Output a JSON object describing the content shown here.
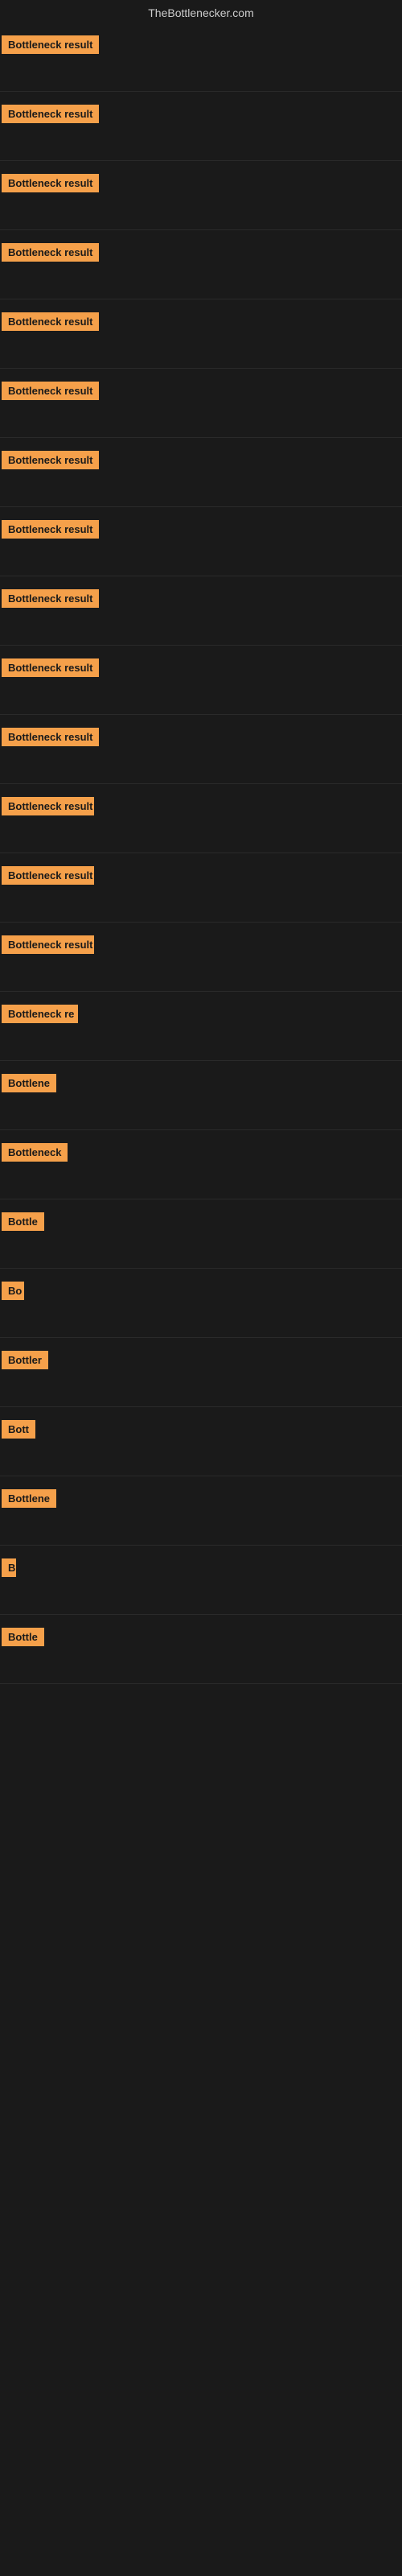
{
  "site": {
    "title": "TheBottlenecker.com"
  },
  "rows": [
    {
      "id": 1,
      "label": "Bottleneck result",
      "width": 130
    },
    {
      "id": 2,
      "label": "Bottleneck result",
      "width": 130
    },
    {
      "id": 3,
      "label": "Bottleneck result",
      "width": 130
    },
    {
      "id": 4,
      "label": "Bottleneck result",
      "width": 130
    },
    {
      "id": 5,
      "label": "Bottleneck result",
      "width": 130
    },
    {
      "id": 6,
      "label": "Bottleneck result",
      "width": 130
    },
    {
      "id": 7,
      "label": "Bottleneck result",
      "width": 130
    },
    {
      "id": 8,
      "label": "Bottleneck result",
      "width": 130
    },
    {
      "id": 9,
      "label": "Bottleneck result",
      "width": 130
    },
    {
      "id": 10,
      "label": "Bottleneck result",
      "width": 130
    },
    {
      "id": 11,
      "label": "Bottleneck result",
      "width": 130
    },
    {
      "id": 12,
      "label": "Bottleneck result",
      "width": 115
    },
    {
      "id": 13,
      "label": "Bottleneck result",
      "width": 115
    },
    {
      "id": 14,
      "label": "Bottleneck result",
      "width": 115
    },
    {
      "id": 15,
      "label": "Bottleneck re",
      "width": 95
    },
    {
      "id": 16,
      "label": "Bottlene",
      "width": 75
    },
    {
      "id": 17,
      "label": "Bottleneck",
      "width": 85
    },
    {
      "id": 18,
      "label": "Bottle",
      "width": 60
    },
    {
      "id": 19,
      "label": "Bo",
      "width": 28
    },
    {
      "id": 20,
      "label": "Bottler",
      "width": 62
    },
    {
      "id": 21,
      "label": "Bott",
      "width": 45
    },
    {
      "id": 22,
      "label": "Bottlene",
      "width": 72
    },
    {
      "id": 23,
      "label": "B",
      "width": 18
    },
    {
      "id": 24,
      "label": "Bottle",
      "width": 58
    }
  ]
}
